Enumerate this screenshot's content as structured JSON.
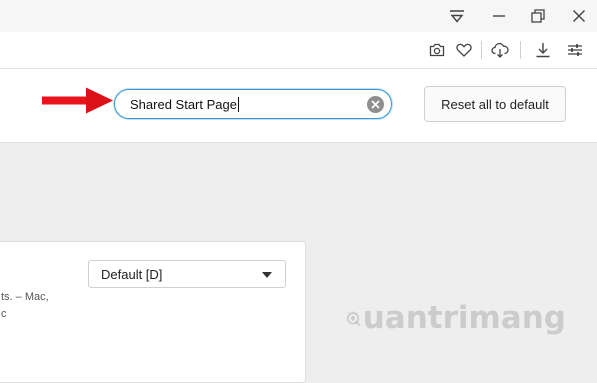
{
  "window": {
    "controls": [
      "menu-icon",
      "minimize-icon",
      "restore-icon",
      "close-icon"
    ]
  },
  "toolbar": {
    "icons": [
      "camera-icon",
      "heart-icon",
      "cloud-sync-icon",
      "download-icon",
      "settings-sliders-icon"
    ]
  },
  "search": {
    "value": "Shared Start Page",
    "clear_icon": "clear-circle-icon"
  },
  "reset_button": {
    "label": "Reset all to default"
  },
  "annotation": {
    "arrow_color": "#e8131b"
  },
  "setting": {
    "select_value": "Default [D]",
    "description_lines": [
      "ts. – Mac,",
      "c"
    ]
  },
  "watermark": {
    "text": "uantrimang",
    "logo_icon": "bulb-q-logo-icon"
  },
  "colors": {
    "accent": "#3c9bd6",
    "arrow": "#e8131b",
    "background": "#eeeeee"
  }
}
